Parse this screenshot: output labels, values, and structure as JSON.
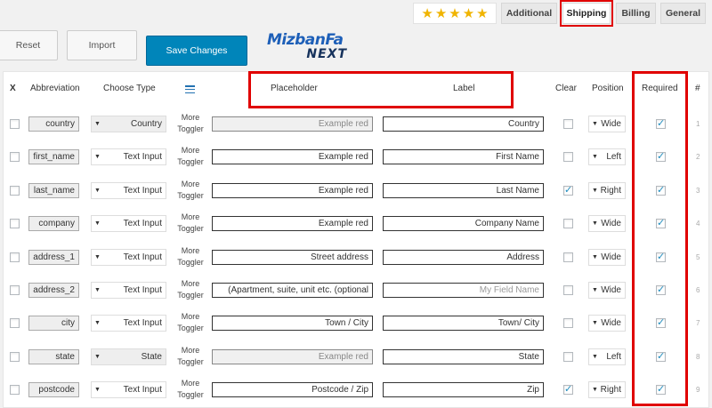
{
  "tabs": {
    "rating_stars": 5,
    "items": [
      "Additional",
      "Shipping",
      "Billing",
      "General"
    ],
    "active": "Shipping",
    "accent_color": "#e00000"
  },
  "toolbar": {
    "reset_label": "Reset",
    "import_label": "Import",
    "save_label": "Save Changes",
    "save_color": "#0085ba"
  },
  "logo": {
    "top": "MizbanFa",
    "bottom": "NEXT"
  },
  "columns": {
    "x": "X",
    "abbreviation": "Abbreviation",
    "choose_type": "Choose Type",
    "placeholder": "Placeholder",
    "label": "Label",
    "clear": "Clear",
    "position": "Position",
    "required": "Required",
    "num": "#"
  },
  "rows": [
    {
      "abbr": "country",
      "type": "Country",
      "type_disabled": true,
      "toggler": [
        "More",
        "Toggler"
      ],
      "placeholder": "Example red",
      "placeholder_disabled": true,
      "label": "Country",
      "label_is_placeholder": false,
      "clear": false,
      "position": "Wide",
      "required": true,
      "num": "1"
    },
    {
      "abbr": "first_name",
      "type": "Text Input",
      "type_disabled": false,
      "toggler": [
        "More",
        "Toggler"
      ],
      "placeholder": "Example red",
      "placeholder_disabled": false,
      "label": "First Name",
      "label_is_placeholder": false,
      "clear": false,
      "position": "Left",
      "required": true,
      "num": "2"
    },
    {
      "abbr": "last_name",
      "type": "Text Input",
      "type_disabled": false,
      "toggler": [
        "More",
        "Toggler"
      ],
      "placeholder": "Example red",
      "placeholder_disabled": false,
      "label": "Last Name",
      "label_is_placeholder": false,
      "clear": true,
      "position": "Right",
      "required": true,
      "num": "3"
    },
    {
      "abbr": "company",
      "type": "Text Input",
      "type_disabled": false,
      "toggler": [
        "More",
        "Toggler"
      ],
      "placeholder": "Example red",
      "placeholder_disabled": false,
      "label": "Company Name",
      "label_is_placeholder": false,
      "clear": false,
      "position": "Wide",
      "required": true,
      "num": "4"
    },
    {
      "abbr": "address_1",
      "type": "Text Input",
      "type_disabled": false,
      "toggler": [
        "More",
        "Toggler"
      ],
      "placeholder": "Street address",
      "placeholder_disabled": false,
      "label": "Address",
      "label_is_placeholder": false,
      "clear": false,
      "position": "Wide",
      "required": true,
      "num": "5"
    },
    {
      "abbr": "address_2",
      "type": "Text Input",
      "type_disabled": false,
      "toggler": [
        "More",
        "Toggler"
      ],
      "placeholder": "(Apartment, suite, unit etc. (optional",
      "placeholder_disabled": false,
      "label": "My Field Name",
      "label_is_placeholder": true,
      "clear": false,
      "position": "Wide",
      "required": true,
      "num": "6"
    },
    {
      "abbr": "city",
      "type": "Text Input",
      "type_disabled": false,
      "toggler": [
        "More",
        "Toggler"
      ],
      "placeholder": "Town / City",
      "placeholder_disabled": false,
      "label": "Town/ City",
      "label_is_placeholder": false,
      "clear": false,
      "position": "Wide",
      "required": true,
      "num": "7"
    },
    {
      "abbr": "state",
      "type": "State",
      "type_disabled": true,
      "toggler": [
        "More",
        "Toggler"
      ],
      "placeholder": "Example red",
      "placeholder_disabled": true,
      "label": "State",
      "label_is_placeholder": false,
      "clear": false,
      "position": "Left",
      "required": true,
      "num": "8"
    },
    {
      "abbr": "postcode",
      "type": "Text Input",
      "type_disabled": false,
      "toggler": [
        "More",
        "Toggler"
      ],
      "placeholder": "Postcode / Zip",
      "placeholder_disabled": false,
      "label": "Zip",
      "label_is_placeholder": false,
      "clear": true,
      "position": "Right",
      "required": true,
      "num": "9"
    }
  ]
}
